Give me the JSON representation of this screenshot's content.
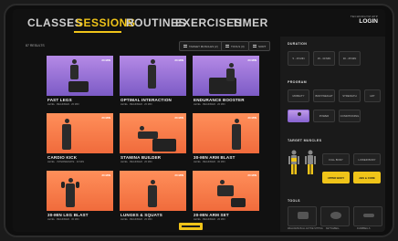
{
  "nav": {
    "tabs": [
      {
        "label": "CLASSES",
        "active": false
      },
      {
        "label": "SESSIONS",
        "active": true
      },
      {
        "label": "ROUTINES",
        "active": false
      },
      {
        "label": "EXERCISES",
        "active": false
      },
      {
        "label": "TIMER",
        "active": false
      }
    ],
    "login_caption": "TECHNOGYM APP",
    "login_label": "LOGIN"
  },
  "results": {
    "count_label": "87 RESULTS",
    "buttons": [
      "TARGET MUSCLES (2)",
      "TOOLS (3)",
      "SORT"
    ]
  },
  "sessions": [
    {
      "title": "FAST LEGS",
      "meta": "LEVEL · BEGINNER · 20 MIN",
      "duration": "20 MIN",
      "color": "purple"
    },
    {
      "title": "OPTIMAL INTERACTION",
      "meta": "LEVEL · BEGINNER · 20 MIN",
      "duration": "20 MIN",
      "color": "purple"
    },
    {
      "title": "ENDURANCE BOOSTER",
      "meta": "LEVEL · BEGINNER · 20 MIN",
      "duration": "20 MIN",
      "color": "purple"
    },
    {
      "title": "CARDIO KICK",
      "meta": "LEVEL · INTERMEDIATE · 20 MIN",
      "duration": "20 MIN",
      "color": "orange"
    },
    {
      "title": "STAMINA BUILDER",
      "meta": "LEVEL · BEGINNER · 20 MIN",
      "duration": "20 MIN",
      "color": "orange"
    },
    {
      "title": "30-MIN ARM BLAST",
      "meta": "LEVEL · BEGINNER · 30 MIN",
      "duration": "30 MIN",
      "color": "orange"
    },
    {
      "title": "30-MIN LEG BLAST",
      "meta": "LEVEL · BEGINNER · 30 MIN",
      "duration": "30 MIN",
      "color": "orange"
    },
    {
      "title": "LUNGES & SQUATS",
      "meta": "LEVEL · BEGINNER · 20 MIN",
      "duration": "20 MIN",
      "color": "orange"
    },
    {
      "title": "20-MIN ARM SET",
      "meta": "LEVEL · BEGINNER · 20 MIN",
      "duration": "20 MIN",
      "color": "orange"
    }
  ],
  "filters": {
    "duration_label": "DURATION",
    "durations": [
      "5 - 15 MIN",
      "15 - 30 MIN",
      "30 - 45 MIN"
    ],
    "program_label": "PROGRAM",
    "programs": [
      "MOBILITY",
      "BODYWEIGHT",
      "STRENGTH",
      "HIIT",
      "",
      "POWER",
      "CONDITIONING"
    ],
    "target_label": "TARGET MUSCLES",
    "targets": [
      "FULL BODY",
      "LOWER BODY",
      "UPPER BODY",
      "ABS & CORE"
    ],
    "tools_label": "TOOLS",
    "tools": [
      "WELLNESS BALL ACTIVE SITTING",
      "KETTLEBELL",
      "DUMBBELLS"
    ]
  },
  "colors": {
    "accent": "#f0c419",
    "purple": "#9b73d9",
    "orange": "#f47a45"
  }
}
